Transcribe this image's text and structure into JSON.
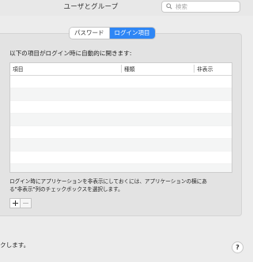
{
  "window": {
    "title": "ユーザとグループ",
    "search_placeholder": "検索"
  },
  "tabs": [
    {
      "label": "パスワード",
      "selected": false
    },
    {
      "label": "ログイン項目",
      "selected": true
    }
  ],
  "login_items": {
    "heading": "以下の項目がログイン時に自動的に開きます:",
    "columns": [
      "項目",
      "種類",
      "非表示"
    ],
    "rows": [],
    "note_line1": "ログイン時にアプリケーションを非表示にしておくには、アプリケーションの横にあ",
    "note_line2": "る\"非表示\"列のチェックボックスを選択します。",
    "add_label": "+",
    "remove_label": "−"
  },
  "footer": {
    "text": "クします。",
    "help_label": "?"
  },
  "colors": {
    "accent": "#2e86f5",
    "background": "#ececec"
  }
}
